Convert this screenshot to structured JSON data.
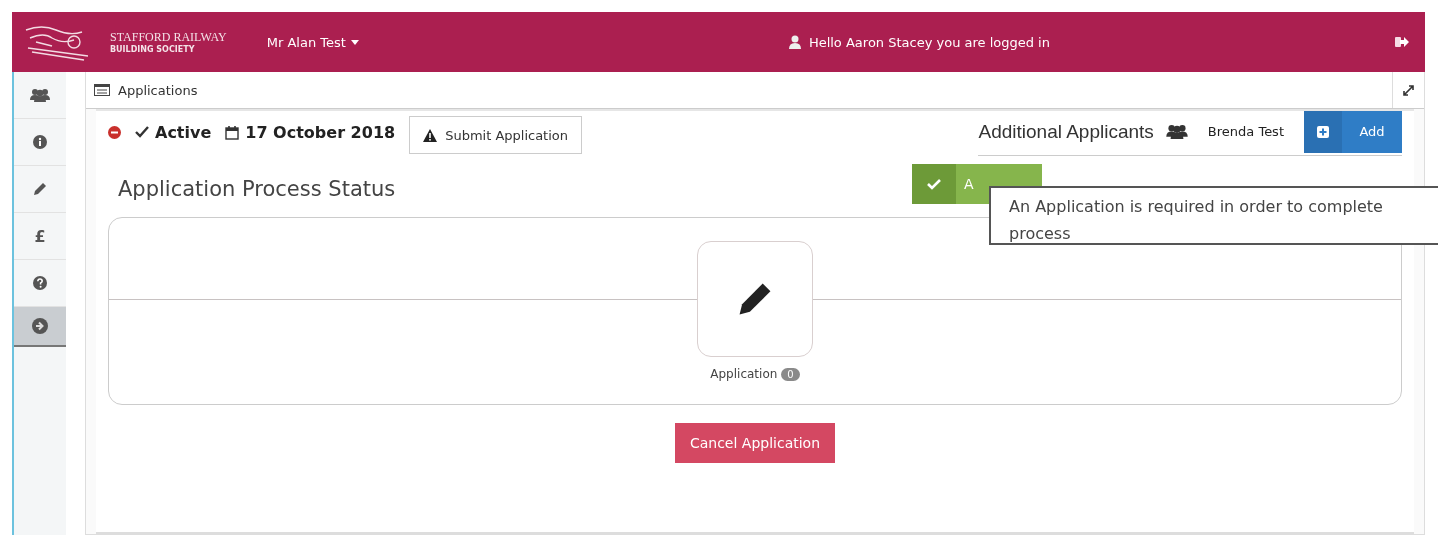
{
  "header": {
    "brand_line_1": "STAFFORD RAILWAY",
    "brand_line_2": "BUILDING SOCIETY",
    "user_menu": "Mr Alan Test",
    "greeting": "Hello Aaron Stacey you are logged in"
  },
  "sidebar": {
    "items": [
      {
        "kind": "users",
        "selected": false
      },
      {
        "kind": "info",
        "selected": false
      },
      {
        "kind": "pencil",
        "selected": false
      },
      {
        "kind": "glyph",
        "glyph": "£",
        "selected": false
      },
      {
        "kind": "question",
        "selected": false
      },
      {
        "kind": "arrow",
        "selected": true
      }
    ]
  },
  "panel": {
    "title": "Applications"
  },
  "status_bar": {
    "status": "Active",
    "date": "17 October 2018",
    "submit_button": "Submit Application",
    "additional_applicants_label": "Additional Applicants",
    "applicants": [
      "Brenda Test"
    ],
    "add_button": "Add"
  },
  "process": {
    "heading": "Application Process Status",
    "approve_button": "A",
    "tooltip": "An Application is required in order to complete process",
    "steps": [
      {
        "label": "Application",
        "count": "0"
      }
    ],
    "cancel_button": "Cancel Application"
  }
}
